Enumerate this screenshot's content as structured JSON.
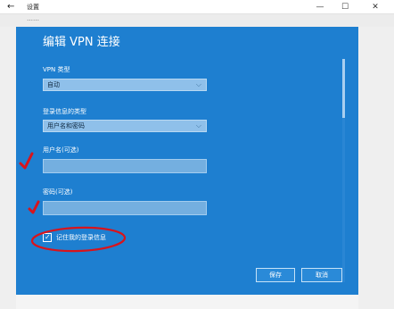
{
  "window": {
    "title": "设置",
    "back_glyph": "←",
    "minimize_glyph": "—",
    "maximize_glyph": "☐",
    "close_glyph": "✕",
    "background_text": "……"
  },
  "dialog": {
    "title": "编辑 VPN 连接",
    "vpn_type_label": "VPN 类型",
    "vpn_type_value": "自动",
    "signin_type_label": "登录信息的类型",
    "signin_type_value": "用户名和密码",
    "username_label": "用户名(可选)",
    "username_value": "",
    "password_label": "密码(可选)",
    "password_value": "",
    "remember_label": "记住我的登录信息",
    "remember_checked": true,
    "save_label": "保存",
    "cancel_label": "取消",
    "chevron_glyph": "⌵",
    "check_glyph": "✓"
  },
  "colors": {
    "dialog_bg": "#1e7fd0",
    "annotation_red": "#d8141c"
  }
}
